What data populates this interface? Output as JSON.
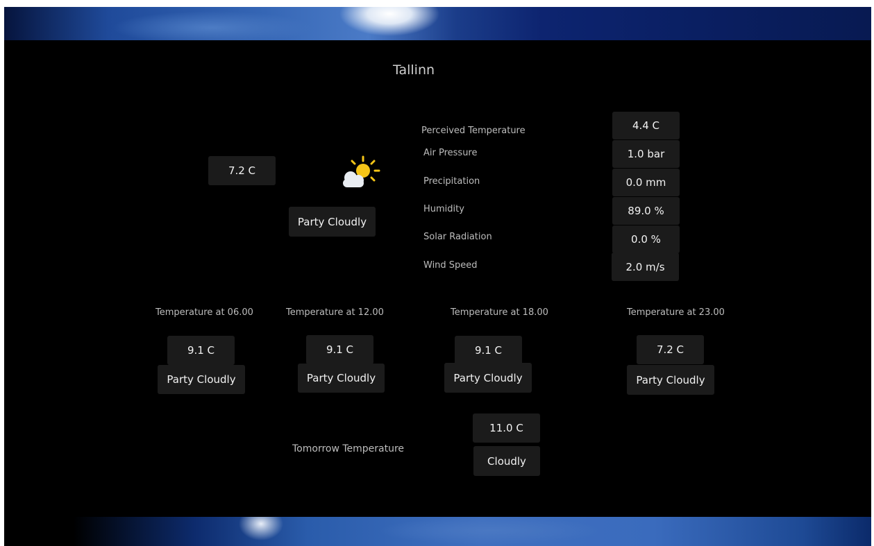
{
  "city": "Tallinn",
  "current": {
    "temperature": "7.2 C",
    "condition": "Party Cloudly",
    "icon": "partly-cloudy-icon"
  },
  "details": [
    {
      "label": "Perceived Temperature",
      "value": "4.4 C"
    },
    {
      "label": "Air Pressure",
      "value": "1.0 bar"
    },
    {
      "label": "Precipitation",
      "value": "0.0 mm"
    },
    {
      "label": "Humidity",
      "value": "89.0 %"
    },
    {
      "label": "Solar Radiation",
      "value": "0.0 %"
    },
    {
      "label": "Wind Speed",
      "value": "2.0 m/s"
    }
  ],
  "forecast": [
    {
      "label": "Temperature at 06.00",
      "temperature": "9.1 C",
      "condition": "Party Cloudly"
    },
    {
      "label": "Temperature at 12.00",
      "temperature": "9.1 C",
      "condition": "Party Cloudly"
    },
    {
      "label": "Temperature at 18.00",
      "temperature": "9.1 C",
      "condition": "Party Cloudly"
    },
    {
      "label": "Temperature at 23.00",
      "temperature": "7.2 C",
      "condition": "Party Cloudly"
    }
  ],
  "tomorrow": {
    "label": "Tomorrow Temperature",
    "temperature": "11.0 C",
    "condition": "Cloudly"
  },
  "colors": {
    "background": "#000000",
    "box": "#1b1b1b",
    "sun": "#f5c518",
    "cloud": "#e9edf2"
  }
}
